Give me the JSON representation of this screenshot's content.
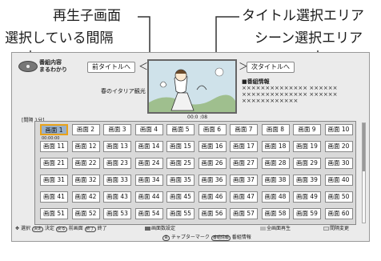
{
  "callouts": {
    "preview": "再生子画面",
    "title_select": "タイトル選択エリア",
    "interval": "選択している間隔",
    "scene_select": "シーン選択エリア"
  },
  "header": {
    "logo_line1": "番組内容",
    "logo_line2": "まるわかり",
    "prev_title": "前タイトルへ",
    "next_title": "次タイトルへ",
    "prev_arrow": "＜",
    "next_arrow": "＞"
  },
  "program": {
    "title": "春のイタリア観光",
    "timecode": "00:0 :08",
    "info_heading": "■番組情報",
    "info_lines": [
      "×××××××××××××× ××××××",
      "×××××××××××××× ××××××",
      "××××××××××××"
    ]
  },
  "interval_label": "[間隔 1分]",
  "grid": {
    "cells": [
      "画面 1",
      "画面 2",
      "画面 3",
      "画面 4",
      "画面 5",
      "画面 6",
      "画面 7",
      "画面 8",
      "画面 9",
      "画面 10",
      "画面 11",
      "画面 12",
      "画面 13",
      "画面 14",
      "画面 15",
      "画面 16",
      "画面 17",
      "画面 18",
      "画面 19",
      "画面 20",
      "画面 21",
      "画面 22",
      "画面 23",
      "画面 24",
      "画面 25",
      "画面 26",
      "画面 27",
      "画面 28",
      "画面 29",
      "画面 30",
      "画面 31",
      "画面 32",
      "画面 33",
      "画面 34",
      "画面 35",
      "画面 36",
      "画面 37",
      "画面 38",
      "画面 39",
      "画面 40",
      "画面 41",
      "画面 42",
      "画面 43",
      "画面 44",
      "画面 45",
      "画面 46",
      "画面 47",
      "画面 48",
      "画面 49",
      "画面 50",
      "画面 51",
      "画面 52",
      "画面 53",
      "画面 54",
      "画面 55",
      "画面 56",
      "画面 57",
      "画面 58",
      "画面 59",
      "画面 60"
    ],
    "first_cell_time": "00:00:00"
  },
  "help": {
    "select": "選択",
    "decide_key": "決定",
    "decide": "決定",
    "prev_screen_key": "戻る",
    "prev_screen": "前画面",
    "end_key": "終了",
    "end": "終了",
    "screen_setting": "画面数設定",
    "full_play": "全画面再生",
    "interval_change": "間隔変更",
    "chapter_key": "青",
    "chapter": "チャプターマーク",
    "info_key": "番組情報",
    "info": "番組情報"
  },
  "colors": {
    "selection_border": "#e8a21a",
    "selection_fill": "#9ab0c8"
  }
}
